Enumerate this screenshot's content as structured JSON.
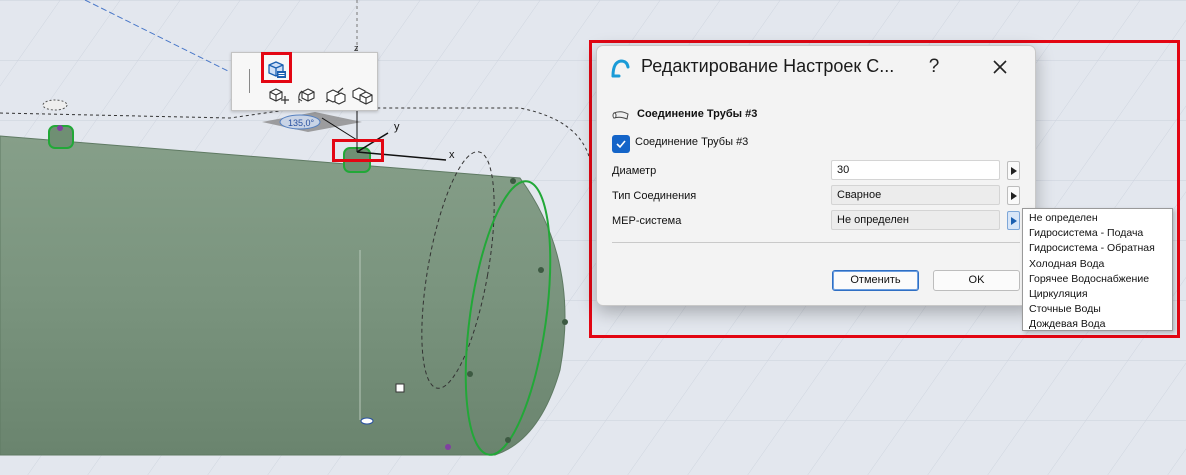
{
  "viewport": {
    "axis_labels": {
      "z": "z",
      "y": "y",
      "x": "x"
    },
    "angle_readout": "135,0°",
    "colors": {
      "background": "#e3e7ee",
      "pipe_body": "#7c9680",
      "connector_green": "#22a838",
      "highlight_red": "#e30613"
    }
  },
  "toolbar": {
    "icons": [
      "pipe-settings-icon",
      "move-icon",
      "rotate-icon",
      "stretch-icon",
      "multiply-icon"
    ]
  },
  "dialog": {
    "title": "Редактирование Настроек С...",
    "help_label": "?",
    "section_title": "Соединение Трубы #3",
    "checkbox_label": "Соединение Трубы #3",
    "checkbox_checked": true,
    "rows": [
      {
        "label": "Диаметр",
        "value": "30"
      },
      {
        "label": "Тип Соединения",
        "value": "Сварное"
      },
      {
        "label": "MEP-система",
        "value": "Не определен"
      }
    ],
    "cancel_label": "Отменить",
    "ok_label": "OK",
    "accent_color": "#1464c8"
  },
  "dropdown": {
    "selected": "Не определен",
    "options": [
      "Не определен",
      "Гидросистема - Подача",
      "Гидросистема - Обратная",
      "Холодная Вода",
      "Горячее Водоснабжение",
      "Циркуляция",
      "Сточные Воды",
      "Дождевая Вода"
    ]
  }
}
